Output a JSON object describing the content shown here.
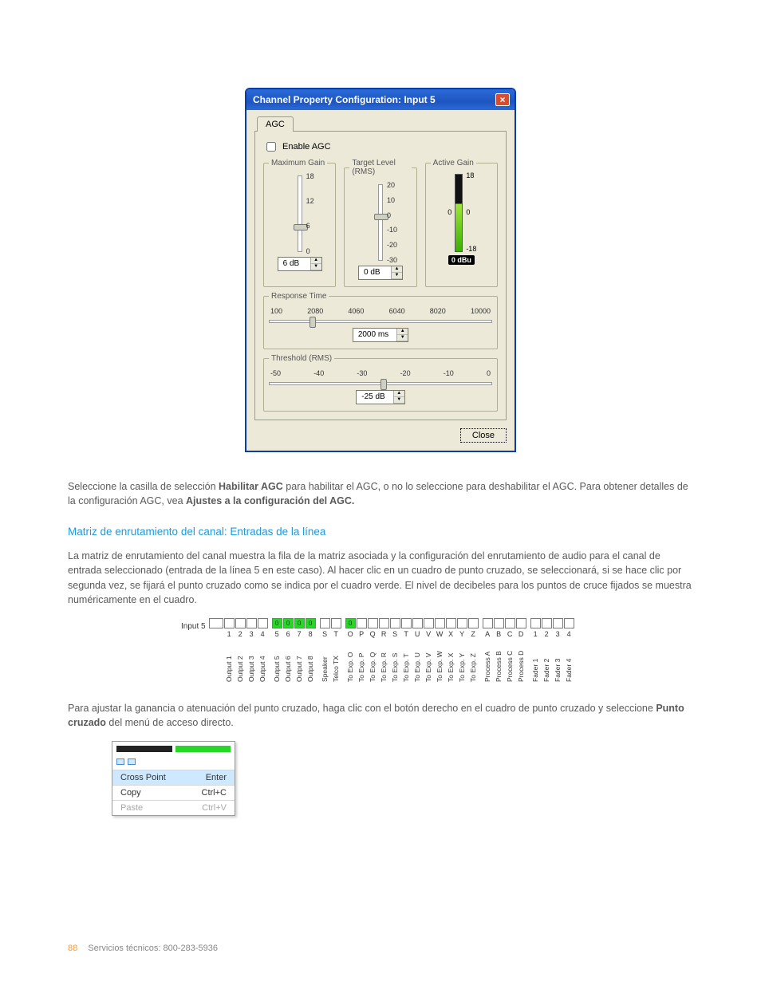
{
  "dialog": {
    "title": "Channel Property Configuration: Input 5",
    "tab": "AGC",
    "enable_label": "Enable AGC",
    "close_button": "Close",
    "max_gain": {
      "legend": "Maximum Gain",
      "ticks": [
        "18",
        "12",
        "6",
        "0"
      ],
      "value": "6 dB"
    },
    "target_level": {
      "legend": "Target Level (RMS)",
      "ticks": [
        "20",
        "10",
        "0",
        "-10",
        "-20",
        "-30"
      ],
      "value": "0 dB"
    },
    "active_gain": {
      "legend": "Active Gain",
      "left_ticks": [
        "0"
      ],
      "right_ticks": [
        "18",
        "0",
        "-18"
      ],
      "badge": "0 dBu"
    },
    "response_time": {
      "legend": "Response Time",
      "ticks": [
        "100",
        "2080",
        "4060",
        "6040",
        "8020",
        "10000"
      ],
      "value": "2000 ms"
    },
    "threshold": {
      "legend": "Threshold (RMS)",
      "ticks": [
        "-50",
        "-40",
        "-30",
        "-20",
        "-10",
        "0"
      ],
      "value": "-25 dB"
    }
  },
  "copy": {
    "p1a": "Seleccione la casilla de selección ",
    "p1b": "Habilitar AGC",
    "p1c": " para habilitar el AGC, o no lo seleccione para deshabilitar el AGC. Para obtener detalles de la configuración AGC, vea ",
    "p1d": "Ajustes a la configuración del AGC.",
    "h3": "Matriz de enrutamiento del canal: Entradas de la línea",
    "p2": "La matriz de enrutamiento del canal muestra la fila de la matriz asociada y la configuración del enrutamiento de audio para el canal de entrada seleccionado (entrada de la línea 5 en este caso). Al hacer clic en un cuadro de punto cruzado, se seleccionará, si se hace clic por segunda vez, se fijará el punto cruzado como se indica por el cuadro verde. El nivel de decibeles para los puntos de cruce fijados se muestra numéricamente en el cuadro.",
    "p3a": "Para ajustar la ganancia o atenuación del punto cruzado, haga clic con el botón derecho en el cuadro de punto cruzado y seleccione ",
    "p3b": "Punto cruzado",
    "p3c": " del menú de acceso directo."
  },
  "matrix": {
    "row_label": "Input 5",
    "groups": [
      {
        "headers": [
          "1",
          "2",
          "3",
          "4"
        ],
        "on": [],
        "vlabels": [
          "Output 1",
          "Output 2",
          "Output 3",
          "Output 4"
        ]
      },
      {
        "headers": [
          "5",
          "6",
          "7",
          "8"
        ],
        "on": [
          0,
          1,
          2,
          3
        ],
        "vlabels": [
          "Output 5",
          "Output 6",
          "Output 7",
          "Output 8"
        ]
      },
      {
        "headers": [
          "S",
          "T"
        ],
        "on": [],
        "vlabels": [
          "Speaker",
          "Telco TX"
        ]
      },
      {
        "headers": [
          "O",
          "P",
          "Q",
          "R",
          "S",
          "T",
          "U",
          "V",
          "W",
          "X",
          "Y",
          "Z"
        ],
        "on": [
          0
        ],
        "vlabels": [
          "To Exp. O",
          "To Exp. P",
          "To Exp. Q",
          "To Exp. R",
          "To Exp. S",
          "To Exp. T",
          "To Exp. U",
          "To Exp. V",
          "To Exp. W",
          "To Exp. X",
          "To Exp. Y",
          "To Exp. Z"
        ]
      },
      {
        "headers": [
          "A",
          "B",
          "C",
          "D"
        ],
        "on": [],
        "vlabels": [
          "Process A",
          "Process B",
          "Process C",
          "Process D"
        ]
      },
      {
        "headers": [
          "1",
          "2",
          "3",
          "4"
        ],
        "on": [],
        "vlabels": [
          "Fader 1",
          "Fader 2",
          "Fader 3",
          "Fader 4"
        ]
      }
    ],
    "on_text": "0"
  },
  "context_menu": {
    "cross_point": {
      "label": "Cross Point",
      "shortcut": "Enter"
    },
    "copy": {
      "label": "Copy",
      "shortcut": "Ctrl+C"
    },
    "paste": {
      "label": "Paste",
      "shortcut": "Ctrl+V"
    }
  },
  "footer": {
    "page_number": "88",
    "text": "Servicios técnicos: 800-283-5936"
  }
}
